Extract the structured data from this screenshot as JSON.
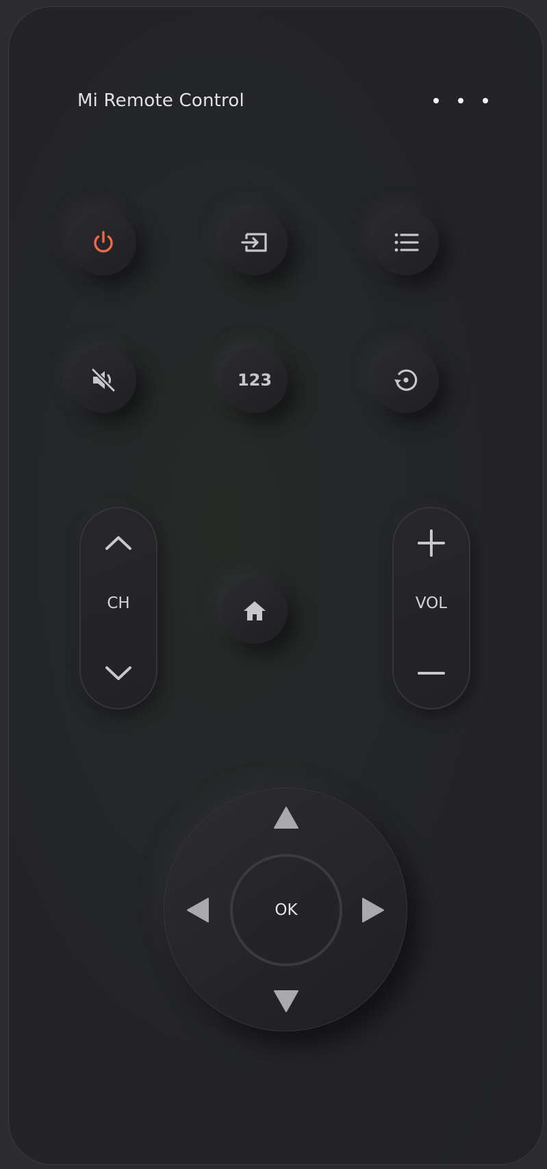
{
  "header": {
    "title": "Mi Remote Control",
    "more_icon": "more-horizontal-icon"
  },
  "buttons": {
    "power": {
      "icon": "power-icon",
      "color": "#ef6a45"
    },
    "input": {
      "icon": "input-source-icon"
    },
    "menu": {
      "icon": "list-menu-icon"
    },
    "mute": {
      "icon": "mute-icon"
    },
    "numpad": {
      "label": "123"
    },
    "back": {
      "icon": "rotate-back-icon"
    },
    "home": {
      "icon": "home-icon"
    }
  },
  "channel": {
    "label": "CH",
    "up_icon": "chevron-up-icon",
    "down_icon": "chevron-down-icon"
  },
  "volume": {
    "label": "VOL",
    "up_icon": "plus-icon",
    "down_icon": "minus-icon"
  },
  "dpad": {
    "ok_label": "OK",
    "icons": [
      "triangle-up-icon",
      "triangle-down-icon",
      "triangle-left-icon",
      "triangle-right-icon"
    ]
  },
  "colors": {
    "background": "#232327",
    "accent_power": "#ef6a45",
    "icon": "#c8c8cc"
  }
}
